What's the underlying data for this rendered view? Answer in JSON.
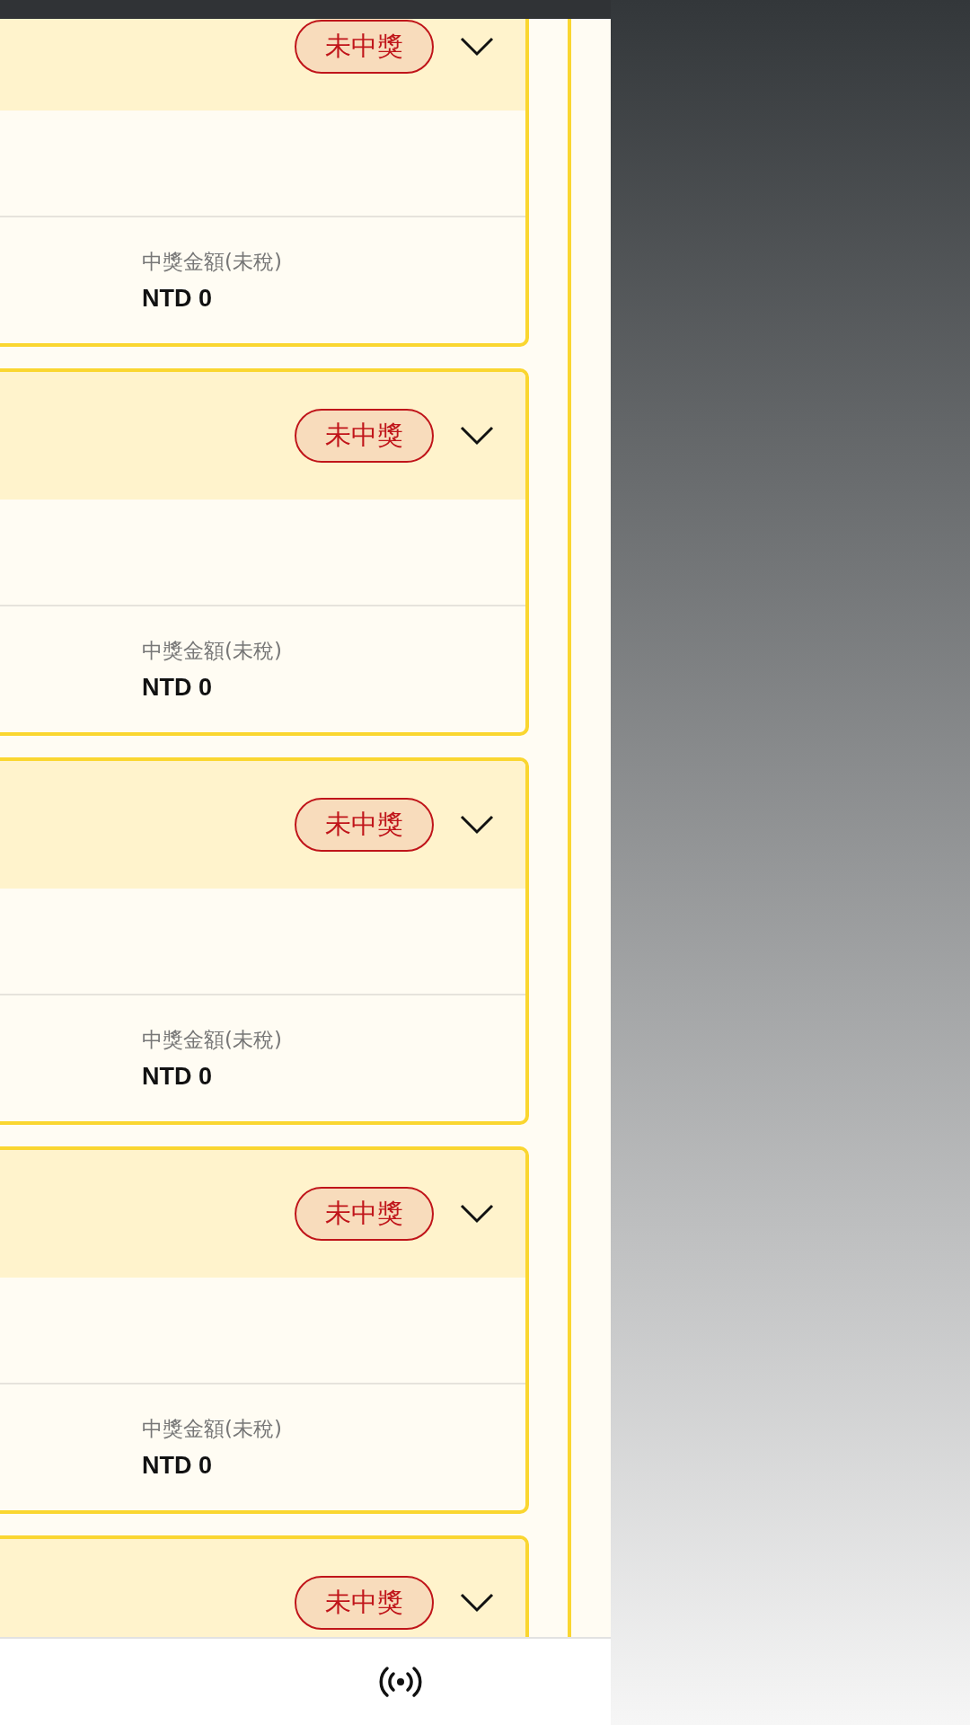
{
  "tickets": [
    {
      "status": "未中獎",
      "expanded": false,
      "prize_label": "中獎金額(未稅)",
      "prize_value": "NTD 0"
    },
    {
      "status": "未中獎",
      "expanded": false,
      "prize_label": "中獎金額(未稅)",
      "prize_value": "NTD 0"
    },
    {
      "status": "未中獎",
      "expanded": false,
      "prize_label": "中獎金額(未稅)",
      "prize_value": "NTD 0"
    },
    {
      "status": "未中獎",
      "expanded": false,
      "prize_label": "中獎金額(未稅)",
      "prize_value": "NTD 0"
    },
    {
      "status": "未中獎",
      "expanded": false
    }
  ]
}
